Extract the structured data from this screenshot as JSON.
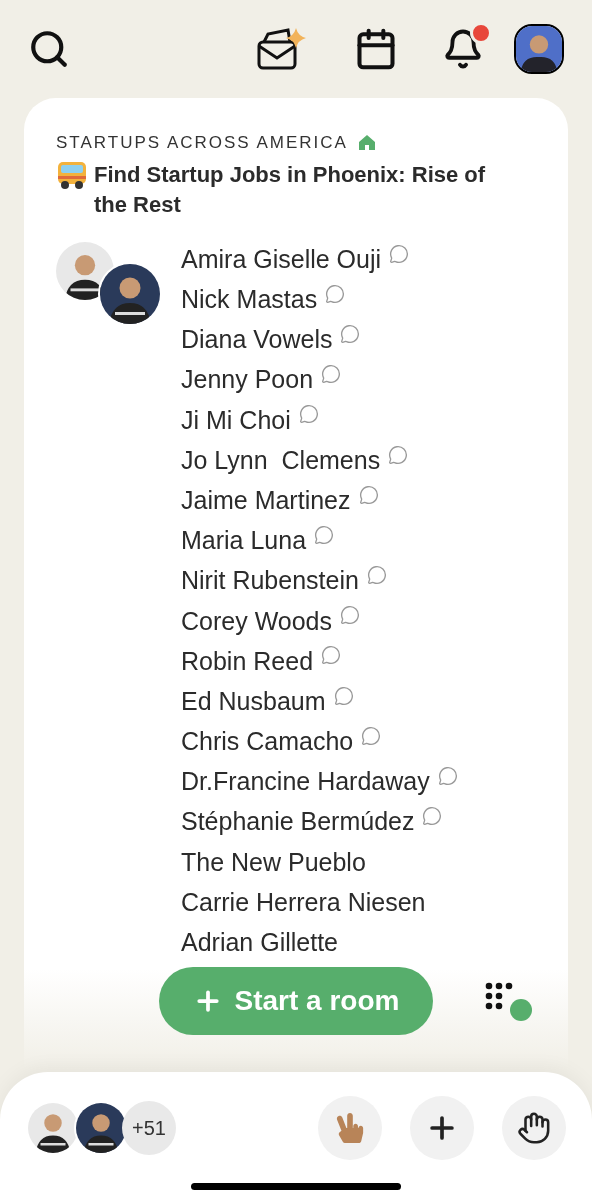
{
  "top_bar": {
    "notification_badge": true
  },
  "room": {
    "club": "STARTUPS ACROSS AMERICA",
    "title": "Find Startup Jobs in Phoenix: Rise of the Rest",
    "speakers": [
      {
        "name": "Amira Giselle Ouji",
        "bubble": true
      },
      {
        "name": "Nick Mastas",
        "bubble": true
      },
      {
        "name": "Diana Vowels",
        "bubble": true
      },
      {
        "name": "Jenny Poon",
        "bubble": true
      },
      {
        "name": "Ji Mi Choi",
        "bubble": true
      },
      {
        "name": "Jo Lynn  Clemens",
        "bubble": true
      },
      {
        "name": "Jaime Martinez",
        "bubble": true
      },
      {
        "name": "Maria Luna",
        "bubble": true
      },
      {
        "name": "Nirit Rubenstein",
        "bubble": true
      },
      {
        "name": "Corey Woods",
        "bubble": true
      },
      {
        "name": "Robin Reed",
        "bubble": true
      },
      {
        "name": "Ed Nusbaum",
        "bubble": true
      },
      {
        "name": "Chris Camacho",
        "bubble": true
      },
      {
        "name": "Dr.Francine Hardaway",
        "bubble": true
      },
      {
        "name": "Stéphanie Bermúdez",
        "bubble": true
      },
      {
        "name": "The New Pueblo",
        "bubble": false
      },
      {
        "name": "Carrie Herrera Niesen",
        "bubble": false
      },
      {
        "name": "Adrian Gillette",
        "bubble": false
      }
    ]
  },
  "start_room_button": {
    "label": "Start a room"
  },
  "bottom_bar": {
    "more_count": "+51"
  }
}
